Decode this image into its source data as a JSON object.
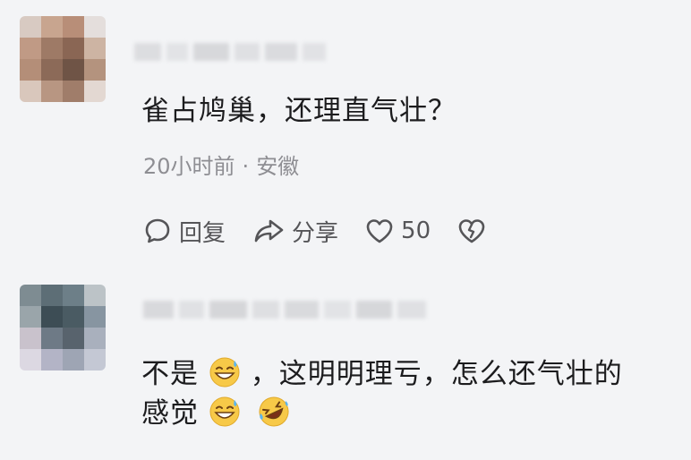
{
  "comments": [
    {
      "text": "雀占鸠巢，还理直气壮？",
      "time": "20小时前",
      "separator": "·",
      "location": "安徽",
      "actions": {
        "reply_label": "回复",
        "share_label": "分享",
        "like_count": "50"
      }
    },
    {
      "text_part1": "不是",
      "text_part2": "，这明明理亏，怎么还气壮的",
      "text_part3": "感觉"
    }
  ],
  "emojis": [
    "grinning-sweat-emoji",
    "rolling-laughing-emoji"
  ],
  "colors": {
    "background": "#f3f4f6",
    "text": "#1c1c1e",
    "meta": "#8e8e93",
    "icon": "#555558"
  }
}
